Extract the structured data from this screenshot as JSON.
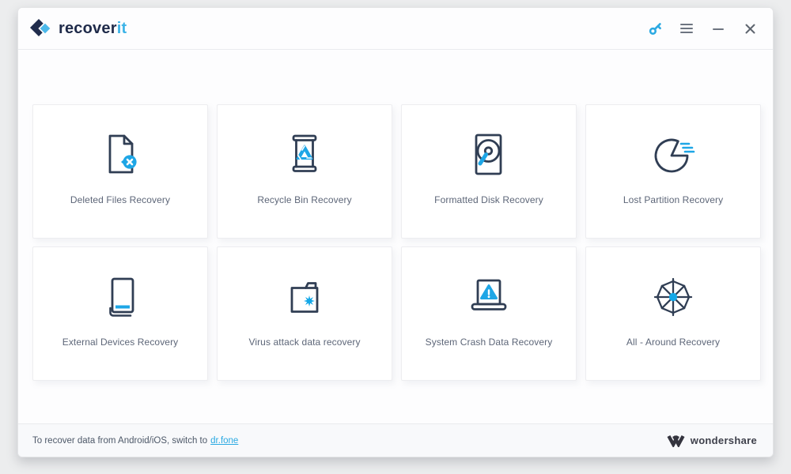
{
  "titlebar": {
    "brand_part1": "recover",
    "brand_part2": "it",
    "icons": [
      "key-icon",
      "menu-icon",
      "minimize-icon",
      "close-icon"
    ]
  },
  "cards": [
    {
      "label": "Deleted Files Recovery",
      "icon": "deleted-file-icon"
    },
    {
      "label": "Recycle Bin Recovery",
      "icon": "recycle-bin-icon"
    },
    {
      "label": "Formatted Disk Recovery",
      "icon": "formatted-disk-icon"
    },
    {
      "label": "Lost Partition Recovery",
      "icon": "lost-partition-icon"
    },
    {
      "label": "External Devices Recovery",
      "icon": "external-device-icon"
    },
    {
      "label": "Virus attack data recovery",
      "icon": "virus-folder-icon"
    },
    {
      "label": "System Crash Data Recovery",
      "icon": "crashed-laptop-icon"
    },
    {
      "label": "All - Around Recovery",
      "icon": "all-around-icon"
    }
  ],
  "footer": {
    "text": "To recover data from Android/iOS, switch to",
    "link_label": "dr.fone",
    "brand": "wondershare"
  },
  "colors": {
    "accent_blue": "#25a8e3",
    "icon_navy": "#303e54",
    "brand_navy": "#1f2b4a",
    "label_gray": "#5d6678"
  }
}
